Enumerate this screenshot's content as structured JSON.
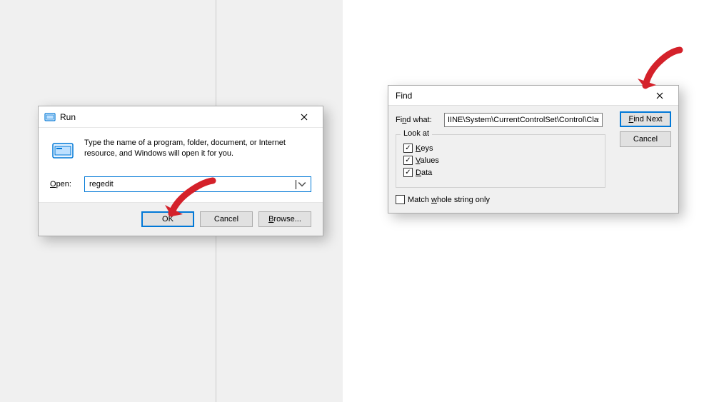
{
  "run": {
    "title": "Run",
    "desc": "Type the name of a program, folder, document, or Internet resource, and Windows will open it for you.",
    "open_label": "Open:",
    "open_value": "regedit",
    "ok": "OK",
    "cancel": "Cancel",
    "browse": "Browse..."
  },
  "find": {
    "title": "Find",
    "find_what_label": "Find what:",
    "find_what_value": "IINE\\System\\CurrentControlSet\\Control\\Class",
    "look_at": "Look at",
    "keys": "Keys",
    "values": "Values",
    "data": "Data",
    "keys_checked": true,
    "values_checked": true,
    "data_checked": true,
    "match_whole": "Match whole string only",
    "match_checked": false,
    "find_next": "Find Next",
    "cancel": "Cancel"
  }
}
